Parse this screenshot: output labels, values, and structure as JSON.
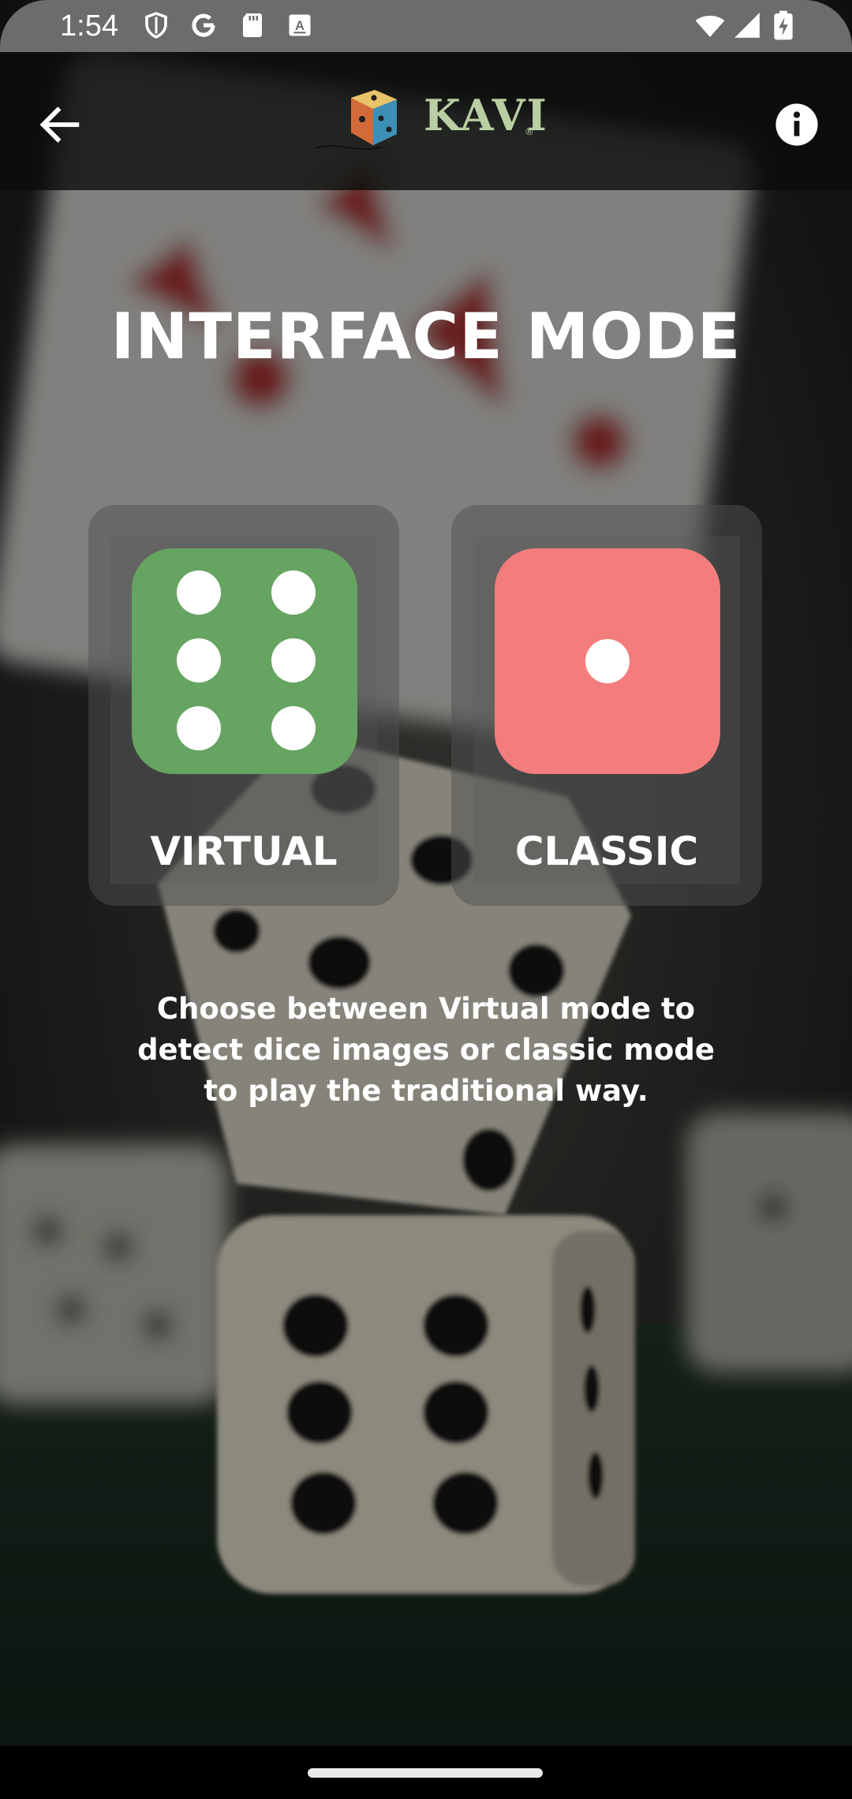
{
  "status_bar": {
    "time": "1:54",
    "icons": [
      "shield-icon",
      "google-icon",
      "sd-card-icon",
      "a-box-icon",
      "wifi-icon",
      "signal-icon",
      "battery-charging-icon"
    ]
  },
  "app_bar": {
    "back_icon": "arrow-left-icon",
    "logo_text": "KAVI",
    "logo_mark": "®",
    "info_icon": "info-icon"
  },
  "title": "INTERFACE MODE",
  "modes": [
    {
      "label": "VIRTUAL",
      "die_face": 6,
      "color": "#66a461"
    },
    {
      "label": "CLASSIC",
      "die_face": 1,
      "color": "#f27d7c"
    }
  ],
  "description": "Choose between Virtual mode to detect dice images or classic mode to play the traditional way.",
  "colors": {
    "virtual_die": "#66a461",
    "classic_die": "#f27d7c",
    "logo": "#b9cfa3",
    "status_bar": "#6c6c6c"
  }
}
